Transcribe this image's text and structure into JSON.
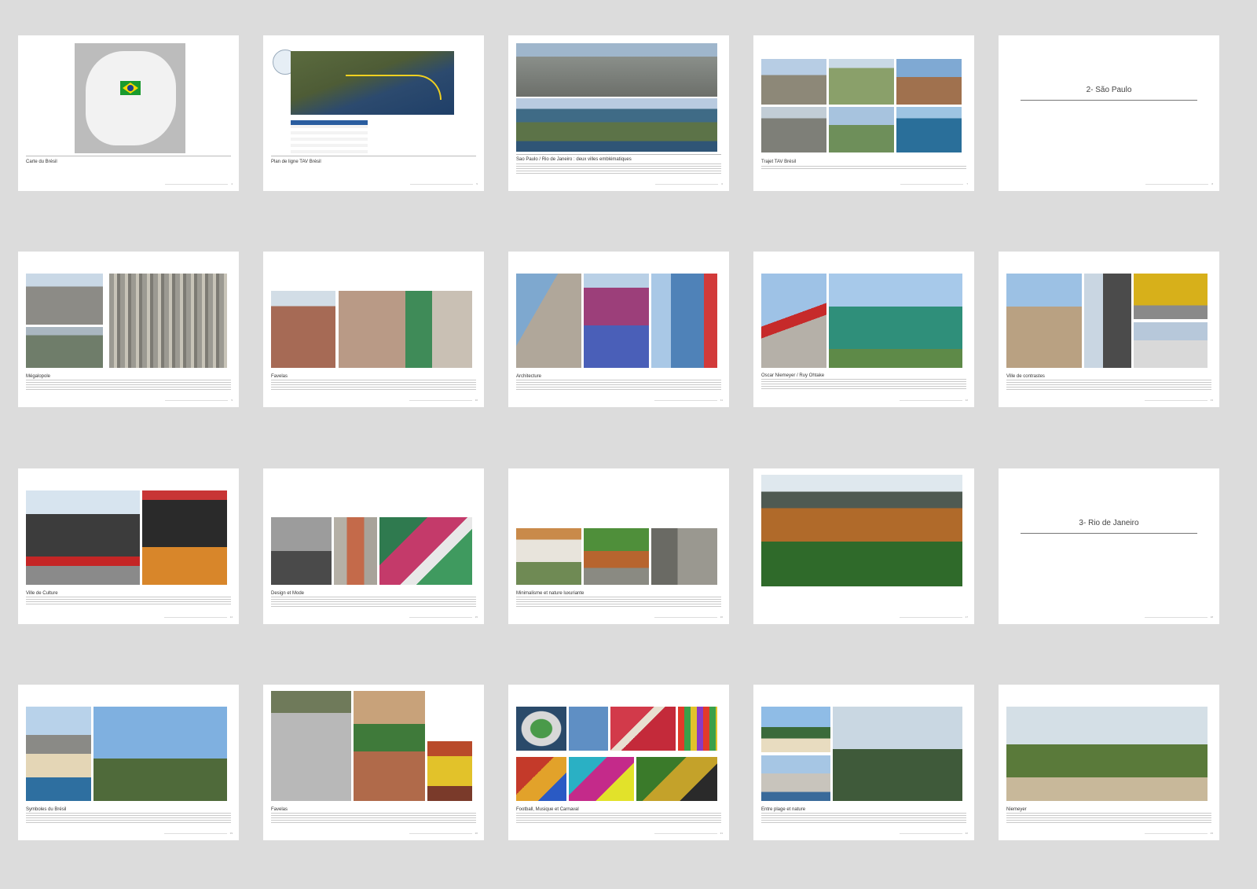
{
  "pages": [
    {
      "caption": "Carte du Brésil",
      "footer": "4"
    },
    {
      "caption": "Plan de ligne TAV Brésil",
      "footer": "5"
    },
    {
      "caption": "Sao Paulo / Rio de Janeiro : deux villes emblématiques",
      "footer": "6"
    },
    {
      "caption": "Trajet TAV Brésil",
      "footer": "7"
    },
    {
      "section_title": "2- São Paulo",
      "footer": "8"
    },
    {
      "caption": "Mégalopole",
      "footer": "9"
    },
    {
      "caption": "Favelas",
      "footer": "10"
    },
    {
      "caption": "Architecture",
      "footer": "11"
    },
    {
      "caption": "Oscar Niemeyer / Ruy Ohtake",
      "footer": "12"
    },
    {
      "caption": "Ville de contrastes",
      "footer": "13"
    },
    {
      "caption": "Ville de Culture",
      "footer": "14"
    },
    {
      "caption": "Design et Mode",
      "footer": "15"
    },
    {
      "caption": "Minimalisme et nature luxuriante",
      "footer": "16"
    },
    {
      "caption": "",
      "footer": "17"
    },
    {
      "section_title": "3- Rio de Janeiro",
      "footer": "18"
    },
    {
      "caption": "Symboles du Brésil",
      "footer": "19"
    },
    {
      "caption": "Favelas",
      "footer": "20"
    },
    {
      "caption": "Football, Musique et Carnaval",
      "footer": "21"
    },
    {
      "caption": "Entre plage et nature",
      "footer": "22"
    },
    {
      "caption": "Niemeyer",
      "footer": "23"
    }
  ],
  "colors": {
    "background": "#dcdcdc",
    "page": "#ffffff",
    "flag_green": "#1a9a2e",
    "flag_yellow": "#f6d800",
    "flag_blue": "#1d3e8f",
    "route": "#f0d020"
  }
}
